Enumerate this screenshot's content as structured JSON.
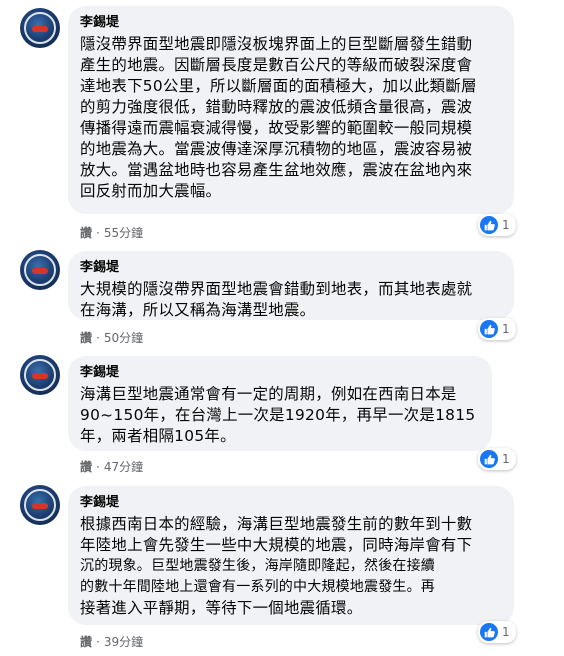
{
  "comments": [
    {
      "author": "李錫堤",
      "lines": [
        "隱沒帶界面型地震即隱沒板塊界面上的巨型斷層發生錯動",
        "產生的地震。因斷層長度是數百公尺的等級而破裂深度會",
        "達地表下50公里，所以斷層面的面積極大，加以此類斷層",
        "的剪力強度很低，錯動時釋放的震波低頻含量很高，震波",
        "傳播得遠而震幅衰減得慢，故受影響的範圍較一般同規模",
        "的地震為大。當震波傳達深厚沉積物的地區，震波容易被",
        "放大。當遇盆地時也容易產生盆地效應，震波在盆地內來",
        "回反射而加大震幅。"
      ],
      "reaction_count": "1",
      "action_label": "讚",
      "time": "55分鐘"
    },
    {
      "author": "李錫堤",
      "lines": [
        "大規模的隱沒帶界面型地震會錯動到地表，而其地表處就",
        "在海溝，所以又稱為海溝型地震。"
      ],
      "reaction_count": "1",
      "action_label": "讚",
      "time": "50分鐘"
    },
    {
      "author": "李錫堤",
      "lines": [
        "海溝巨型地震通常會有一定的周期，例如在西南日本是",
        "90~150年，在台灣上一次是1920年，再早一次是1815",
        "年，兩者相隔105年。"
      ],
      "reaction_count": "1",
      "action_label": "讚",
      "time": "47分鐘"
    },
    {
      "author": "李錫堤",
      "lines": [
        "根據西南日本的經驗，海溝巨型地震發生前的數年到十數",
        "年陸地上會先發生一些中大規模的地震，同時海岸會有下",
        "沉的現象。巨型地震發生後，海岸隨即隆起，然後在接續",
        "的數十年間陸地上還會有一系列的中大規模地震發生。再",
        "接著進入平靜期，等待下一個地震循環。"
      ],
      "reaction_count": "1",
      "action_label": "讚",
      "time": "39分鐘"
    }
  ]
}
